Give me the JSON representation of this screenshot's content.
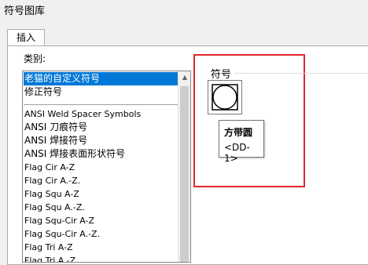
{
  "window": {
    "title": "符号图库"
  },
  "tab": {
    "label": "插入"
  },
  "category": {
    "label": "类别:",
    "items_top": [
      "老猫的自定义符号",
      "修正符号"
    ],
    "items": [
      "ANSI Weld Spacer Symbols",
      "ANSI 刀痕符号",
      "ANSI 焊接符号",
      "ANSI 焊接表面形状符号",
      "Flag Cir A-Z",
      "Flag Cir A.-Z.",
      "Flag Squ A-Z",
      "Flag Squ A.-Z.",
      "Flag Squ-Cir A-Z",
      "Flag Squ-Cir A.-Z.",
      "Flag Tri A-Z",
      "Flag Tri A.-Z."
    ],
    "selected_index": 0
  },
  "symbols": {
    "label": "符号",
    "items": [
      {
        "icon": "circle-in-square-icon"
      }
    ]
  },
  "tooltip": {
    "name": "方带圆",
    "code": "<DD-1>"
  },
  "colors": {
    "selection": "#0078d7",
    "highlight": "#e0262c"
  }
}
